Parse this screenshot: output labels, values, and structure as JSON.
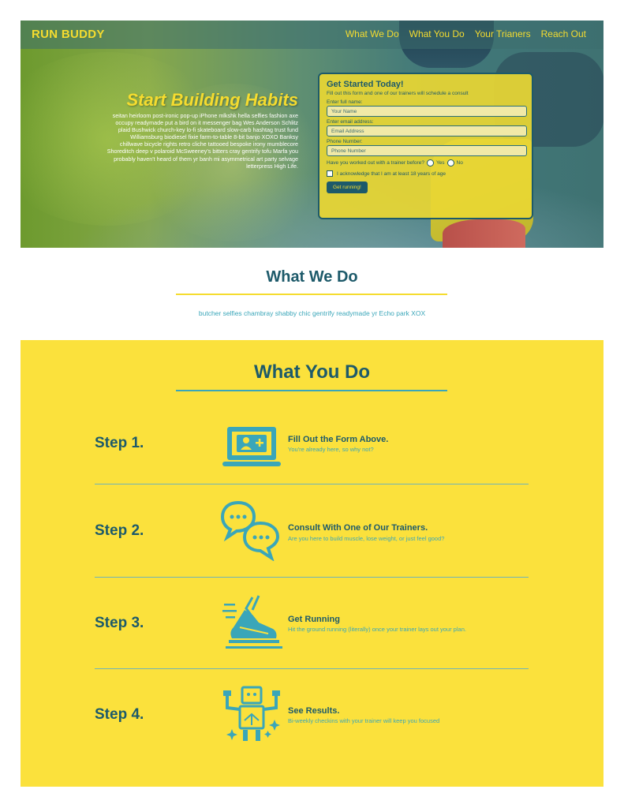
{
  "nav": {
    "brand": "RUN BUDDY",
    "links": [
      "What We Do",
      "What You Do",
      "Your Trianers",
      "Reach Out"
    ]
  },
  "hero": {
    "title": "Start Building Habits",
    "text": "seitan heirloom post-ironic pop-up iPhone mlkshk hella selfies fashion axe occupy readymade put a bird on it messenger bag Wes Anderson Schlitz plaid Bushwick church-key lo-fi skateboard slow-carb hashtag trust fund Williamsburg biodiesel fixie farm-to-table 8-bit banjo XOXO Banksy chillwave bicycle rights retro cliche tattooed bespoke irony mumblecore Shoreditch deep v polaroid McSweeney's bitters cray gentrify tofu Marfa you probably haven't heard of them yr banh mi asymmetrical art party selvage letterpress High Life."
  },
  "form": {
    "title": "Get Started Today!",
    "subtitle": "Fill out this form and one of our trainers will schedule a consult",
    "name_label": "Enter full name:",
    "name_placeholder": "Your Name",
    "email_label": "Enter email address:",
    "email_placeholder": "Email Address",
    "phone_label": "Phone Number:",
    "phone_placeholder": "Phone Number",
    "question": "Have you worked out with a trainer before?",
    "yes": "Yes",
    "no": "No",
    "acknowledge": "I acknowledge that I am at least 18 years of age",
    "submit": "Get running!"
  },
  "what_we_do": {
    "title": "What We Do",
    "text": "butcher selfies chambray shabby chic gentrify readymade yr Echo park XOX"
  },
  "what_you_do": {
    "title": "What You Do",
    "steps": [
      {
        "label": "Step 1.",
        "heading": "Fill Out the Form Above.",
        "desc": "You're already here, so why not?",
        "icon": "laptop-user-icon"
      },
      {
        "label": "Step 2.",
        "heading": "Consult With One of Our Trainers.",
        "desc": "Are you here to build muscle, lose weight, or just feel good?",
        "icon": "chat-bubbles-icon"
      },
      {
        "label": "Step 3.",
        "heading": "Get Running",
        "desc": "Hit the ground running (literally) once your trainer lays out your plan.",
        "icon": "running-shoe-icon"
      },
      {
        "label": "Step 4.",
        "heading": "See Results.",
        "desc": "Bi-weekly checkins with your trainer will keep you focused",
        "icon": "strong-robot-icon"
      }
    ]
  },
  "colors": {
    "primary": "#1d5a6a",
    "accent": "#f5dc2f",
    "secondary": "#3aa6b9"
  }
}
